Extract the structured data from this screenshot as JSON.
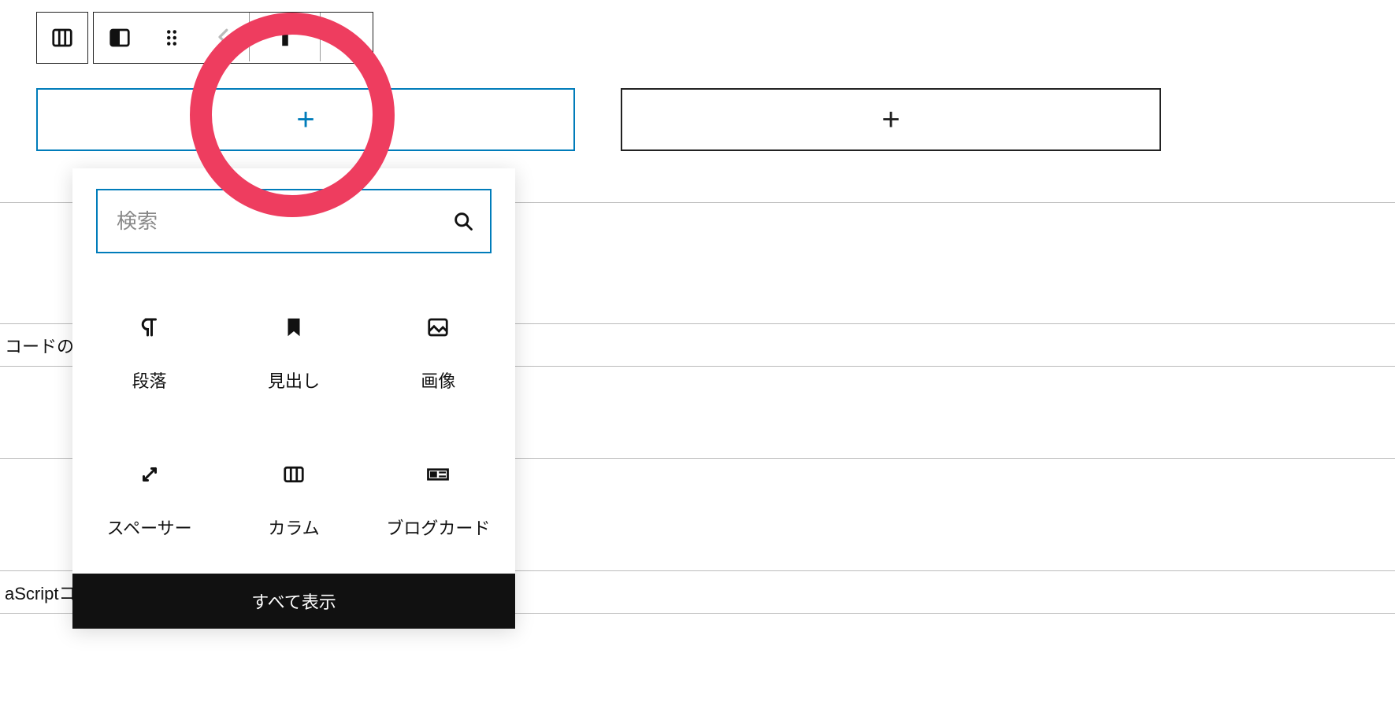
{
  "toolbar": {
    "columns_icon": "columns",
    "column_icon": "half-column",
    "drag_icon": "drag",
    "prev_icon": "chevron-left",
    "align_icon": "align",
    "more_icon": "more-vertical"
  },
  "addButtons": {
    "left_plus": "+",
    "right_plus": "+"
  },
  "search": {
    "placeholder": "検索"
  },
  "blocks": [
    {
      "id": "paragraph",
      "label": "段落"
    },
    {
      "id": "heading",
      "label": "見出し"
    },
    {
      "id": "image",
      "label": "画像"
    },
    {
      "id": "spacer",
      "label": "スペーサー"
    },
    {
      "id": "columns",
      "label": "カラム"
    },
    {
      "id": "blogcard",
      "label": "ブログカード"
    }
  ],
  "showAll": "すべて表示",
  "bgRows": {
    "code": "コードの",
    "script": "aScriptコ"
  }
}
